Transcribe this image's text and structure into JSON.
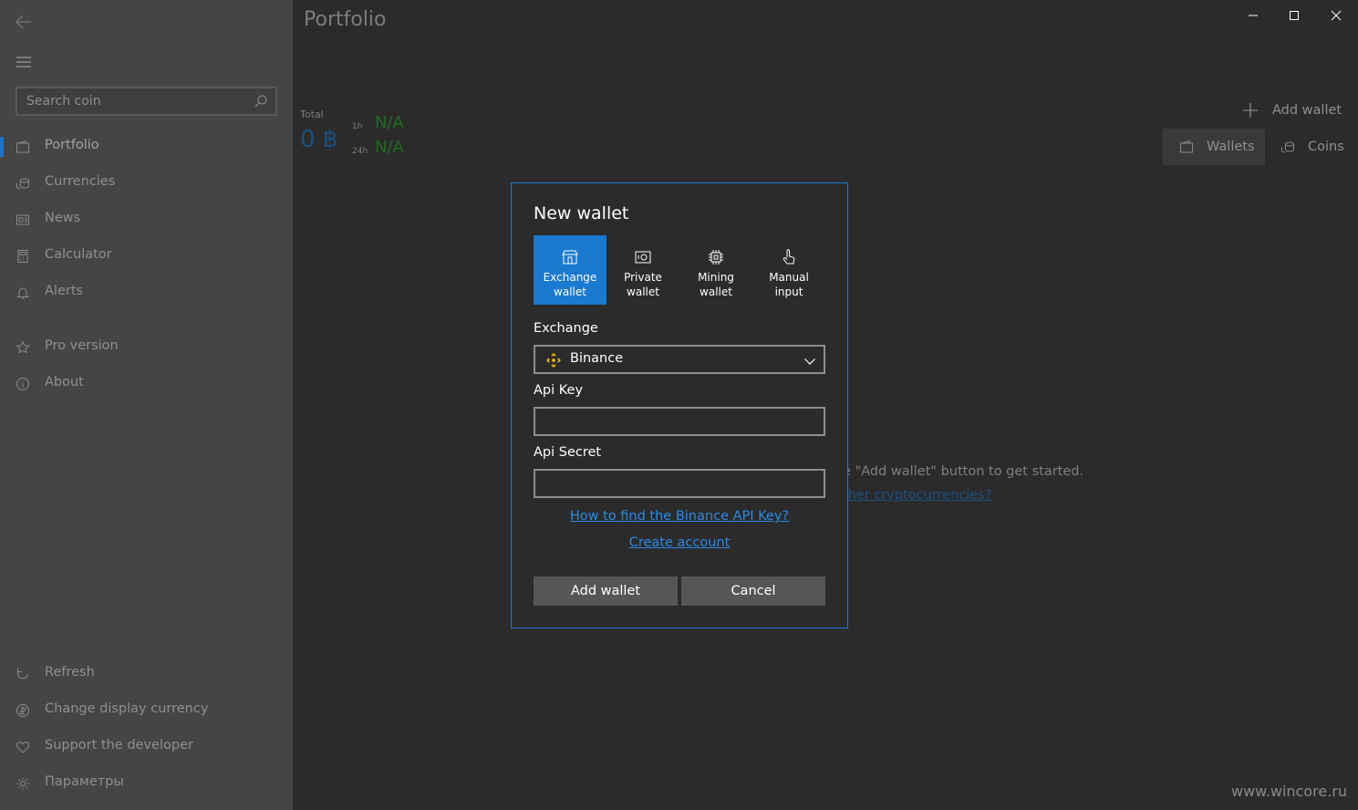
{
  "sidebar": {
    "search_placeholder": "Search coin",
    "nav_items": [
      {
        "label": "Portfolio",
        "icon": "wallet-icon"
      },
      {
        "label": "Currencies",
        "icon": "coins-icon"
      },
      {
        "label": "News",
        "icon": "newspaper-icon"
      },
      {
        "label": "Calculator",
        "icon": "calculator-icon"
      },
      {
        "label": "Alerts",
        "icon": "bell-icon"
      },
      {
        "label": "Pro version",
        "icon": "star-icon"
      },
      {
        "label": "About",
        "icon": "info-icon"
      }
    ],
    "bottom_items": [
      {
        "label": "Refresh",
        "icon": "refresh-icon"
      },
      {
        "label": "Change display currency",
        "icon": "currency-exchange-icon"
      },
      {
        "label": "Support the developer",
        "icon": "heart-icon"
      },
      {
        "label": "Параметры",
        "icon": "gear-icon"
      }
    ]
  },
  "header": {
    "title": "Portfolio"
  },
  "summary": {
    "total_label": "Total",
    "total_value": "0 ฿",
    "change_1h_label": "1h",
    "change_1h_value": "N/A",
    "change_24h_label": "24h",
    "change_24h_value": "N/A"
  },
  "toolbar": {
    "add_wallet_label": "Add wallet",
    "tabs": [
      {
        "label": "Wallets",
        "active": true
      },
      {
        "label": "Coins",
        "active": false
      }
    ]
  },
  "empty_state": {
    "message_partial": "e \"Add wallet\" button to get started.",
    "link_partial": "ther cryptocurrencies?"
  },
  "dialog": {
    "title": "New wallet",
    "wallet_types": [
      {
        "label": "Exchange\nwallet",
        "icon": "exchange-icon",
        "selected": true
      },
      {
        "label": "Private\nwallet",
        "icon": "safe-icon",
        "selected": false
      },
      {
        "label": "Mining\nwallet",
        "icon": "chip-icon",
        "selected": false
      },
      {
        "label": "Manual\ninput",
        "icon": "hand-pointer-icon",
        "selected": false
      }
    ],
    "exchange_label": "Exchange",
    "exchange_value": "Binance",
    "api_key_label": "Api Key",
    "api_key_value": "",
    "api_secret_label": "Api Secret",
    "api_secret_value": "",
    "help_link": "How to find the Binance API Key?",
    "create_account_link": "Create account",
    "add_button": "Add wallet",
    "cancel_button": "Cancel"
  },
  "watermark": "www.wincore.ru",
  "colors": {
    "accent": "#1a7ad0",
    "sidebar_bg": "#454545",
    "main_bg": "#2b2b2b",
    "positive": "#1f6b22",
    "binance": "#f0b90b"
  }
}
